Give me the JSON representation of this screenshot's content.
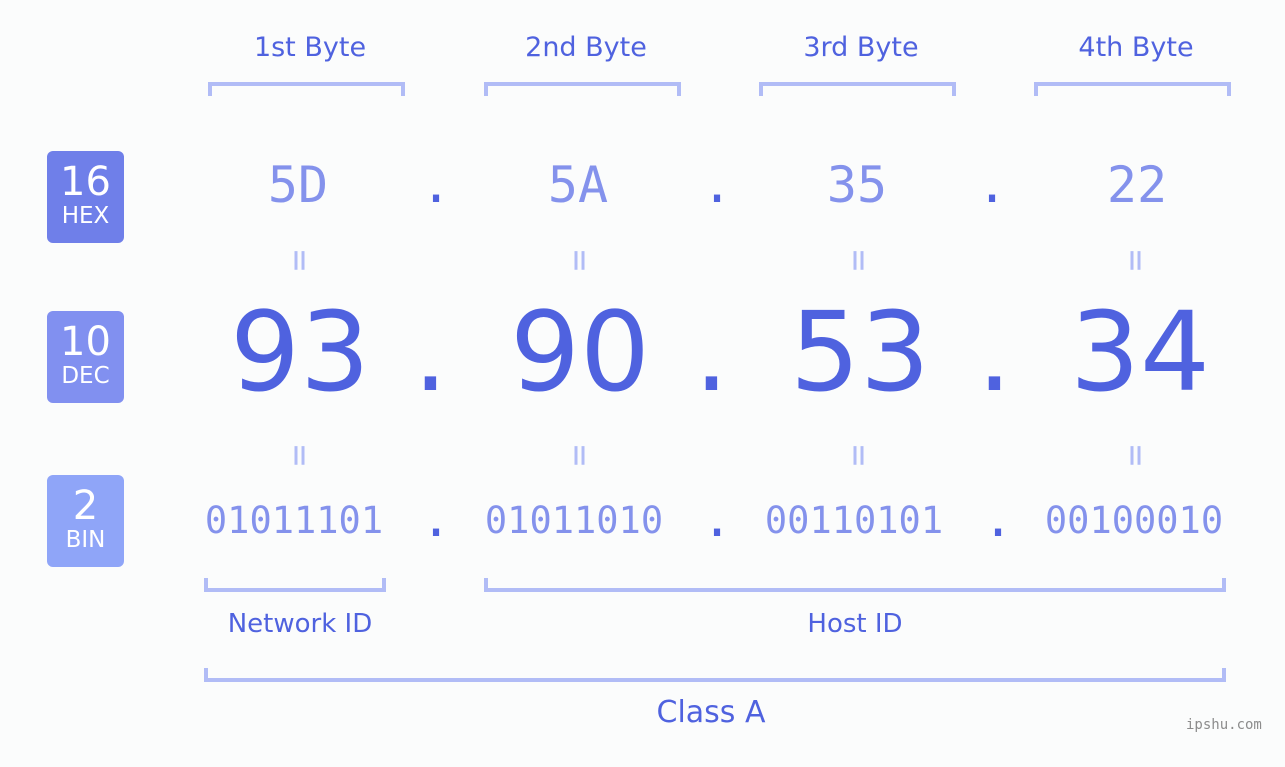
{
  "headers": [
    "1st Byte",
    "2nd Byte",
    "3rd Byte",
    "4th Byte"
  ],
  "badges": [
    {
      "num": "16",
      "label": "HEX",
      "color": "#6f7fe9"
    },
    {
      "num": "10",
      "label": "DEC",
      "color": "#8190f0"
    },
    {
      "num": "2",
      "label": "BIN",
      "color": "#8fa5f8"
    }
  ],
  "hex": [
    "5D",
    "5A",
    "35",
    "22"
  ],
  "dec": [
    "93",
    "90",
    "53",
    "34"
  ],
  "bin": [
    "01011101",
    "01011010",
    "00110101",
    "00100010"
  ],
  "separator": ".",
  "equals": "=",
  "labels": {
    "network": "Network ID",
    "host": "Host ID",
    "class": "Class A"
  },
  "watermark": "ipshu.com",
  "colors": {
    "primary": "#4f62df",
    "light": "#8492ec",
    "bracket": "#b1bcf6"
  }
}
